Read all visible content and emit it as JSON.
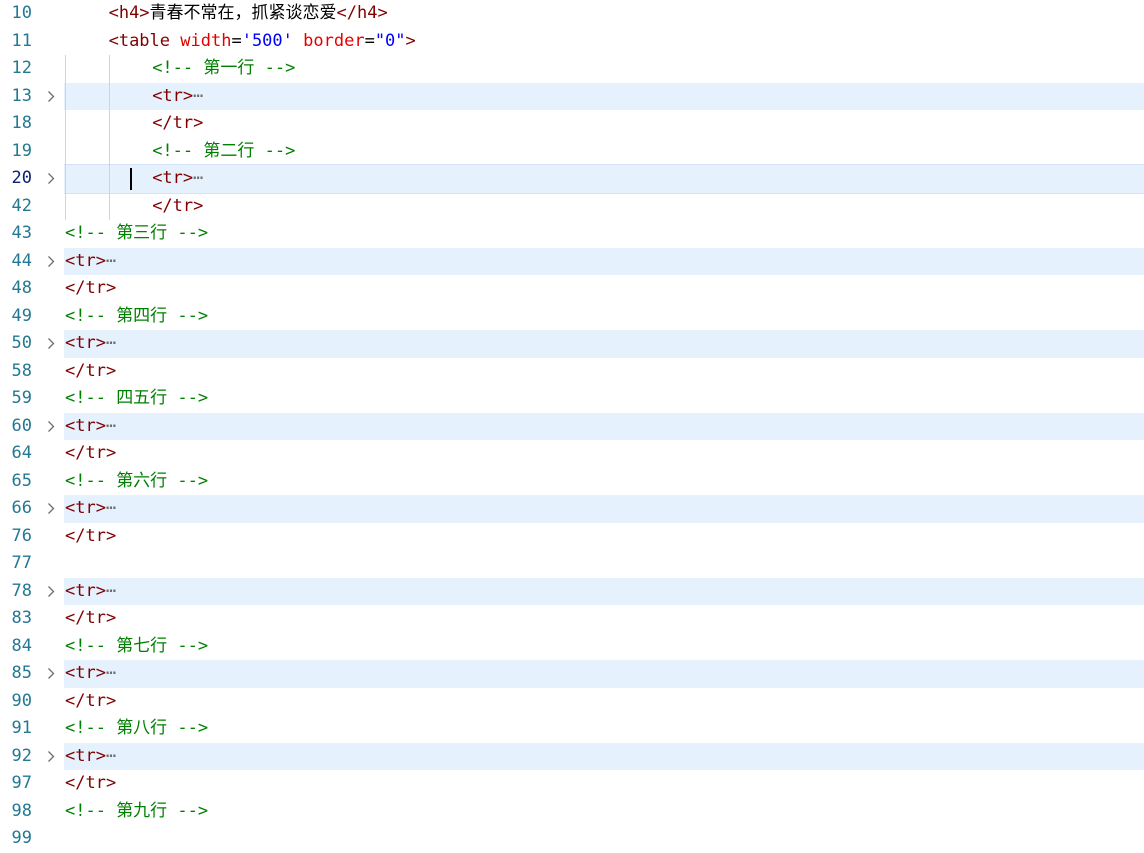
{
  "editor": {
    "lines": [
      {
        "num": "10",
        "indent": 4,
        "folded": false,
        "tokens": [
          {
            "t": "t",
            "v": "<h4>"
          },
          {
            "t": "x",
            "v": "青春不常在，抓紧谈恋爱"
          },
          {
            "t": "t",
            "v": "</h4>"
          }
        ]
      },
      {
        "num": "11",
        "indent": 4,
        "folded": false,
        "tokens": [
          {
            "t": "t",
            "v": "<table"
          },
          {
            "t": "p",
            "v": " "
          },
          {
            "t": "a",
            "v": "width"
          },
          {
            "t": "p",
            "v": "="
          },
          {
            "t": "s",
            "v": "'500'"
          },
          {
            "t": "p",
            "v": " "
          },
          {
            "t": "a",
            "v": "border"
          },
          {
            "t": "p",
            "v": "="
          },
          {
            "t": "s",
            "v": "\"0\""
          },
          {
            "t": "t",
            "v": ">"
          }
        ]
      },
      {
        "num": "12",
        "indent": 8,
        "folded": false,
        "tokens": [
          {
            "t": "c",
            "v": "<!-- "
          },
          {
            "t": "cc",
            "v": "第一行"
          },
          {
            "t": "c",
            "v": " -->"
          }
        ]
      },
      {
        "num": "13",
        "indent": 8,
        "folded": true,
        "tokens": [
          {
            "t": "t",
            "v": "<tr>"
          },
          {
            "t": "dots",
            "v": "⋯"
          }
        ]
      },
      {
        "num": "18",
        "indent": 8,
        "folded": false,
        "tokens": [
          {
            "t": "t",
            "v": "</tr>"
          }
        ]
      },
      {
        "num": "19",
        "indent": 8,
        "folded": false,
        "tokens": [
          {
            "t": "c",
            "v": "<!-- "
          },
          {
            "t": "cc",
            "v": "第二行"
          },
          {
            "t": "c",
            "v": " -->"
          }
        ]
      },
      {
        "num": "20",
        "indent": 8,
        "folded": true,
        "current": true,
        "tokens": [
          {
            "t": "t",
            "v": "<tr>"
          },
          {
            "t": "dots",
            "v": "⋯"
          }
        ]
      },
      {
        "num": "42",
        "indent": 8,
        "folded": false,
        "tokens": [
          {
            "t": "t",
            "v": "</tr>"
          }
        ]
      },
      {
        "num": "43",
        "indent": 0,
        "folded": false,
        "tokens": [
          {
            "t": "c",
            "v": "<!-- "
          },
          {
            "t": "cc",
            "v": "第三行"
          },
          {
            "t": "c",
            "v": " -->"
          }
        ]
      },
      {
        "num": "44",
        "indent": 0,
        "folded": true,
        "tokens": [
          {
            "t": "t",
            "v": "<tr>"
          },
          {
            "t": "dots",
            "v": "⋯"
          }
        ]
      },
      {
        "num": "48",
        "indent": 0,
        "folded": false,
        "tokens": [
          {
            "t": "t",
            "v": "</tr>"
          }
        ]
      },
      {
        "num": "49",
        "indent": 0,
        "folded": false,
        "tokens": [
          {
            "t": "c",
            "v": "<!-- "
          },
          {
            "t": "cc",
            "v": "第四行"
          },
          {
            "t": "c",
            "v": " -->"
          }
        ]
      },
      {
        "num": "50",
        "indent": 0,
        "folded": true,
        "tokens": [
          {
            "t": "t",
            "v": "<tr>"
          },
          {
            "t": "dots",
            "v": "⋯"
          }
        ]
      },
      {
        "num": "58",
        "indent": 0,
        "folded": false,
        "tokens": [
          {
            "t": "t",
            "v": "</tr>"
          }
        ]
      },
      {
        "num": "59",
        "indent": 0,
        "folded": false,
        "tokens": [
          {
            "t": "c",
            "v": "<!-- "
          },
          {
            "t": "cc",
            "v": "四五行"
          },
          {
            "t": "c",
            "v": " -->"
          }
        ]
      },
      {
        "num": "60",
        "indent": 0,
        "folded": true,
        "tokens": [
          {
            "t": "t",
            "v": "<tr>"
          },
          {
            "t": "dots",
            "v": "⋯"
          }
        ]
      },
      {
        "num": "64",
        "indent": 0,
        "folded": false,
        "tokens": [
          {
            "t": "t",
            "v": "</tr>"
          }
        ]
      },
      {
        "num": "65",
        "indent": 0,
        "folded": false,
        "tokens": [
          {
            "t": "c",
            "v": "<!-- "
          },
          {
            "t": "cc",
            "v": "第六行"
          },
          {
            "t": "c",
            "v": " -->"
          }
        ]
      },
      {
        "num": "66",
        "indent": 0,
        "folded": true,
        "tokens": [
          {
            "t": "t",
            "v": "<tr>"
          },
          {
            "t": "dots",
            "v": "⋯"
          }
        ]
      },
      {
        "num": "76",
        "indent": 0,
        "folded": false,
        "tokens": [
          {
            "t": "t",
            "v": "</tr>"
          }
        ]
      },
      {
        "num": "77",
        "indent": 0,
        "folded": false,
        "tokens": []
      },
      {
        "num": "78",
        "indent": 0,
        "folded": true,
        "tokens": [
          {
            "t": "t",
            "v": "<tr>"
          },
          {
            "t": "dots",
            "v": "⋯"
          }
        ]
      },
      {
        "num": "83",
        "indent": 0,
        "folded": false,
        "tokens": [
          {
            "t": "t",
            "v": "</tr>"
          }
        ]
      },
      {
        "num": "84",
        "indent": 0,
        "folded": false,
        "tokens": [
          {
            "t": "c",
            "v": "<!-- "
          },
          {
            "t": "cc",
            "v": "第七行"
          },
          {
            "t": "c",
            "v": " -->"
          }
        ]
      },
      {
        "num": "85",
        "indent": 0,
        "folded": true,
        "tokens": [
          {
            "t": "t",
            "v": "<tr>"
          },
          {
            "t": "dots",
            "v": "⋯"
          }
        ]
      },
      {
        "num": "90",
        "indent": 0,
        "folded": false,
        "tokens": [
          {
            "t": "t",
            "v": "</tr>"
          }
        ]
      },
      {
        "num": "91",
        "indent": 0,
        "folded": false,
        "tokens": [
          {
            "t": "c",
            "v": "<!-- "
          },
          {
            "t": "cc",
            "v": "第八行"
          },
          {
            "t": "c",
            "v": " -->"
          }
        ]
      },
      {
        "num": "92",
        "indent": 0,
        "folded": true,
        "tokens": [
          {
            "t": "t",
            "v": "<tr>"
          },
          {
            "t": "dots",
            "v": "⋯"
          }
        ]
      },
      {
        "num": "97",
        "indent": 0,
        "folded": false,
        "tokens": [
          {
            "t": "t",
            "v": "</tr>"
          }
        ]
      },
      {
        "num": "98",
        "indent": 0,
        "folded": false,
        "tokens": [
          {
            "t": "c",
            "v": "<!-- "
          },
          {
            "t": "cc",
            "v": "第九行"
          },
          {
            "t": "c",
            "v": " -->"
          }
        ]
      },
      {
        "num": "99",
        "indent": 0,
        "folded": false,
        "tokens": []
      }
    ],
    "fold_icon": "chevron-right-icon",
    "colors": {
      "tag": "#800000",
      "attribute": "#e50000",
      "string": "#0000ff",
      "comment": "#008000",
      "line_number": "#237893",
      "folded_highlight": "#e5f1fc"
    }
  }
}
